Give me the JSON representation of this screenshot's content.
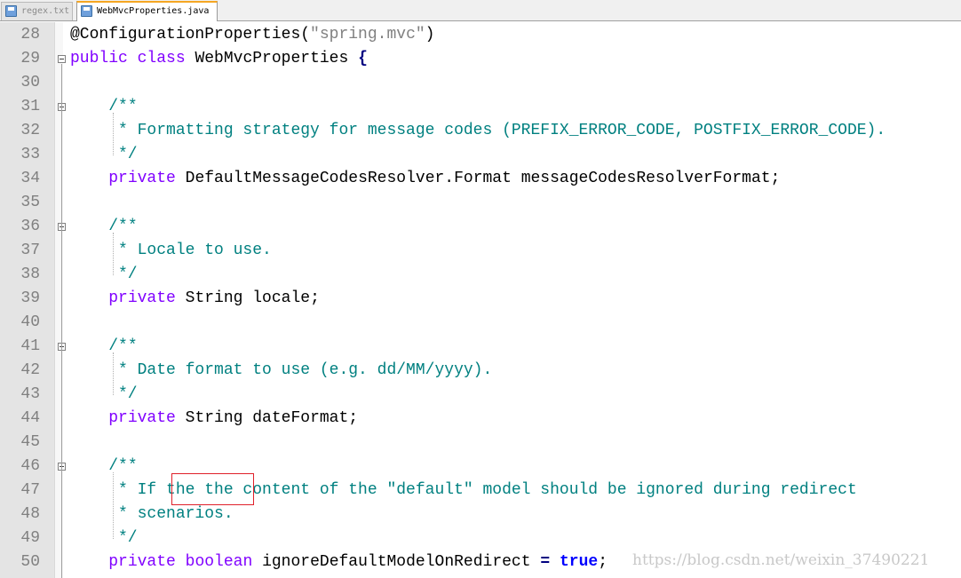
{
  "tabs": [
    {
      "label": "regex.txt",
      "active": false
    },
    {
      "label": "WebMvcProperties.java",
      "active": true
    }
  ],
  "lines": [
    {
      "n": "28",
      "code": [
        [
          "an",
          "@ConfigurationProperties("
        ],
        [
          "str",
          "\"spring.mvc\""
        ],
        [
          "an",
          ")"
        ]
      ]
    },
    {
      "n": "29",
      "code": [
        [
          "kw",
          "public"
        ],
        [
          "pl",
          " "
        ],
        [
          "kw",
          "class"
        ],
        [
          "pl",
          " WebMvcProperties "
        ],
        [
          "op",
          "{"
        ]
      ]
    },
    {
      "n": "30",
      "code": []
    },
    {
      "n": "31",
      "code": [
        [
          "pl",
          "    "
        ],
        [
          "cm",
          "/**"
        ]
      ]
    },
    {
      "n": "32",
      "code": [
        [
          "cm",
          "     * Formatting strategy for message codes (PREFIX_ERROR_CODE, POSTFIX_ERROR_CODE)."
        ]
      ]
    },
    {
      "n": "33",
      "code": [
        [
          "cm",
          "     */"
        ]
      ]
    },
    {
      "n": "34",
      "code": [
        [
          "pl",
          "    "
        ],
        [
          "kw",
          "private"
        ],
        [
          "pl",
          " DefaultMessageCodesResolver.Format messageCodesResolverFormat;"
        ]
      ]
    },
    {
      "n": "35",
      "code": []
    },
    {
      "n": "36",
      "code": [
        [
          "pl",
          "    "
        ],
        [
          "cm",
          "/**"
        ]
      ]
    },
    {
      "n": "37",
      "code": [
        [
          "cm",
          "     * Locale to use."
        ]
      ]
    },
    {
      "n": "38",
      "code": [
        [
          "cm",
          "     */"
        ]
      ]
    },
    {
      "n": "39",
      "code": [
        [
          "pl",
          "    "
        ],
        [
          "kw",
          "private"
        ],
        [
          "pl",
          " String locale;"
        ]
      ]
    },
    {
      "n": "40",
      "code": []
    },
    {
      "n": "41",
      "code": [
        [
          "pl",
          "    "
        ],
        [
          "cm",
          "/**"
        ]
      ]
    },
    {
      "n": "42",
      "code": [
        [
          "cm",
          "     * Date format to use (e.g. dd/MM/yyyy)."
        ]
      ]
    },
    {
      "n": "43",
      "code": [
        [
          "cm",
          "     */"
        ]
      ]
    },
    {
      "n": "44",
      "code": [
        [
          "pl",
          "    "
        ],
        [
          "kw",
          "private"
        ],
        [
          "pl",
          " String dateFormat;"
        ]
      ]
    },
    {
      "n": "45",
      "code": []
    },
    {
      "n": "46",
      "code": [
        [
          "pl",
          "    "
        ],
        [
          "cm",
          "/**"
        ]
      ]
    },
    {
      "n": "47",
      "code": [
        [
          "cm",
          "     * If the the content of the \"default\" model should be ignored during redirect"
        ]
      ]
    },
    {
      "n": "48",
      "code": [
        [
          "cm",
          "     * scenarios."
        ]
      ]
    },
    {
      "n": "49",
      "code": [
        [
          "cm",
          "     */"
        ]
      ]
    },
    {
      "n": "50",
      "code": [
        [
          "pl",
          "    "
        ],
        [
          "kw",
          "private"
        ],
        [
          "pl",
          " "
        ],
        [
          "kw",
          "boolean"
        ],
        [
          "pl",
          " ignoreDefaultModelOnRedirect "
        ],
        [
          "op",
          "="
        ],
        [
          "pl",
          " "
        ],
        [
          "kw2",
          "true"
        ],
        [
          "pl",
          ";"
        ]
      ]
    }
  ],
  "fold_markers": [
    "29",
    "31",
    "36",
    "41",
    "46"
  ],
  "highlight_text": "the the",
  "watermark": "https://blog.csdn.net/weixin_37490221",
  "colors": {
    "keyword": "#8000ff",
    "comment": "#008080",
    "string": "#808080",
    "literal": "#0000ff",
    "highlight_border": "#e0202a"
  }
}
